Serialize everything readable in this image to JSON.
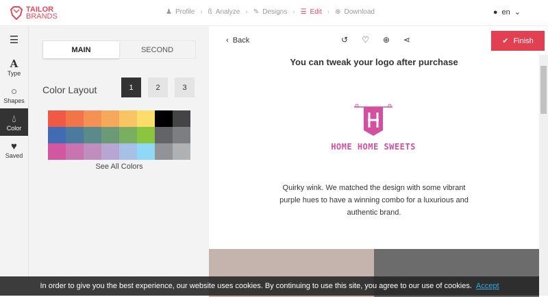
{
  "header": {
    "logo_line1": "TAILOR",
    "logo_line2": "BRANDS",
    "steps": [
      {
        "label": "Profile",
        "icon": "person-icon"
      },
      {
        "label": "Analyze",
        "icon": "analyze-icon"
      },
      {
        "label": "Designs",
        "icon": "pencil-icon"
      },
      {
        "label": "Edit",
        "icon": "sliders-icon"
      },
      {
        "label": "Download",
        "icon": "download-icon"
      }
    ],
    "language": "en"
  },
  "iconbar": {
    "items": [
      {
        "label": "Type"
      },
      {
        "label": "Shapes"
      },
      {
        "label": "Color"
      },
      {
        "label": "Saved"
      }
    ]
  },
  "panel": {
    "tabs": [
      "MAIN",
      "SECOND"
    ],
    "color_layout_label": "Color Layout",
    "layouts": [
      "1",
      "2",
      "3"
    ],
    "see_all": "See All Colors",
    "swatches": [
      "#f05a45",
      "#f27449",
      "#f59153",
      "#f6a95a",
      "#f9c463",
      "#fcdc6a",
      "#000000",
      "#444446",
      "#426bb3",
      "#4c7a9f",
      "#5a8a8c",
      "#6a9b76",
      "#7aae60",
      "#8bc43e",
      "#636467",
      "#7d7e81",
      "#d157a1",
      "#c774b0",
      "#be8ec0",
      "#b7a6d3",
      "#a6c0e6",
      "#8fd8f7",
      "#929396",
      "#b0b1b3"
    ]
  },
  "main": {
    "back": "Back",
    "finish": "Finish",
    "headline": "You can tweak your logo after purchase",
    "brand_name": "HOME HOME SWEETS",
    "description": "Quirky wink. We matched the design with some vibrant purple hues to have a winning combo for a luxurious and authentic brand."
  },
  "cookie": {
    "text": "In order to give you the best experience, our website uses cookies. By continuing to use this site, you agree to our use of cookies.",
    "accept": "Accept"
  },
  "colors": {
    "accent": "#e23f52",
    "brand": "#d2509f"
  }
}
